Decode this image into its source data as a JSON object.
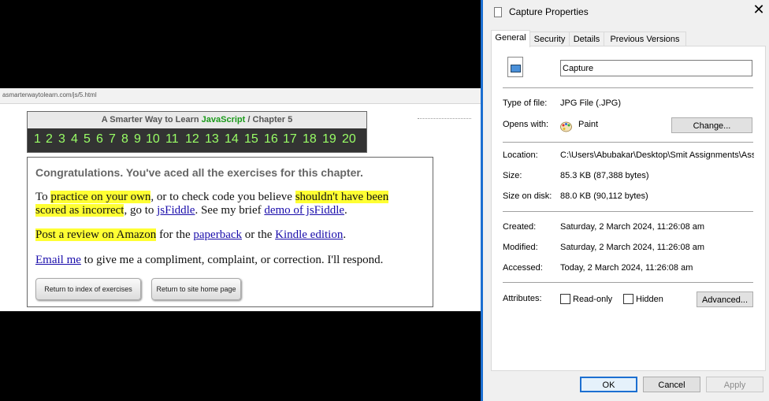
{
  "browser": {
    "url": "asmarterwaytolearn.com/js/5.html",
    "header": {
      "prefix": "A Smarter Way to Learn",
      "brand": "JavaScript",
      "sep": "/",
      "chapter": "Chapter 5"
    },
    "numbers": [
      "1",
      "2",
      "3",
      "4",
      "5",
      "6",
      "7",
      "8",
      "9",
      "10",
      "11",
      "12",
      "13",
      "14",
      "15",
      "16",
      "17",
      "18",
      "19",
      "20"
    ],
    "congrats": "Congratulations. You've aced all the exercises for this chapter.",
    "p1": {
      "a": "To ",
      "b": "practice on your own",
      "c": ", or to check code you believe ",
      "d": "shouldn't have been",
      "e": "scored as incorrect",
      "f": ", go to ",
      "g": "jsFiddle",
      "h": ". See my brief ",
      "i": "demo of jsFiddle",
      "j": "."
    },
    "p2": {
      "a": "Post a review on Amazon",
      "b": " for the ",
      "c": "paperback",
      "d": " or the ",
      "e": "Kindle edition",
      "f": "."
    },
    "p3": {
      "a": "Email me",
      "b": " to give me a compliment, complaint, or correction. I'll respond."
    },
    "btn_index": "Return to index of exercises",
    "btn_home": "Return to site home page"
  },
  "dialog": {
    "title": "Capture Properties",
    "close": "✕",
    "tabs": [
      "General",
      "Security",
      "Details",
      "Previous Versions"
    ],
    "filename": "Capture",
    "rows": {
      "type_label": "Type of file:",
      "type_value": "JPG File (.JPG)",
      "opens_label": "Opens with:",
      "opens_value": "Paint",
      "change_btn": "Change...",
      "location_label": "Location:",
      "location_value": "C:\\Users\\Abubakar\\Desktop\\Smit Assignments\\Ass",
      "size_label": "Size:",
      "size_value": "85.3 KB (87,388 bytes)",
      "disk_label": "Size on disk:",
      "disk_value": "88.0 KB (90,112 bytes)",
      "created_label": "Created:",
      "created_value": "Saturday, 2 March 2024, 11:26:08 am",
      "modified_label": "Modified:",
      "modified_value": "Saturday, 2 March 2024, 11:26:08 am",
      "accessed_label": "Accessed:",
      "accessed_value": "Today, 2 March 2024, 11:26:08 am",
      "attr_label": "Attributes:",
      "readonly": "Read-only",
      "hidden": "Hidden",
      "advanced_btn": "Advanced..."
    },
    "ok": "OK",
    "cancel": "Cancel",
    "apply": "Apply"
  },
  "colors": {
    "accent": "#1c6fd1",
    "highlight": "#ffff33",
    "number_green": "#99ff66",
    "brand_green": "#1a9a1a"
  }
}
